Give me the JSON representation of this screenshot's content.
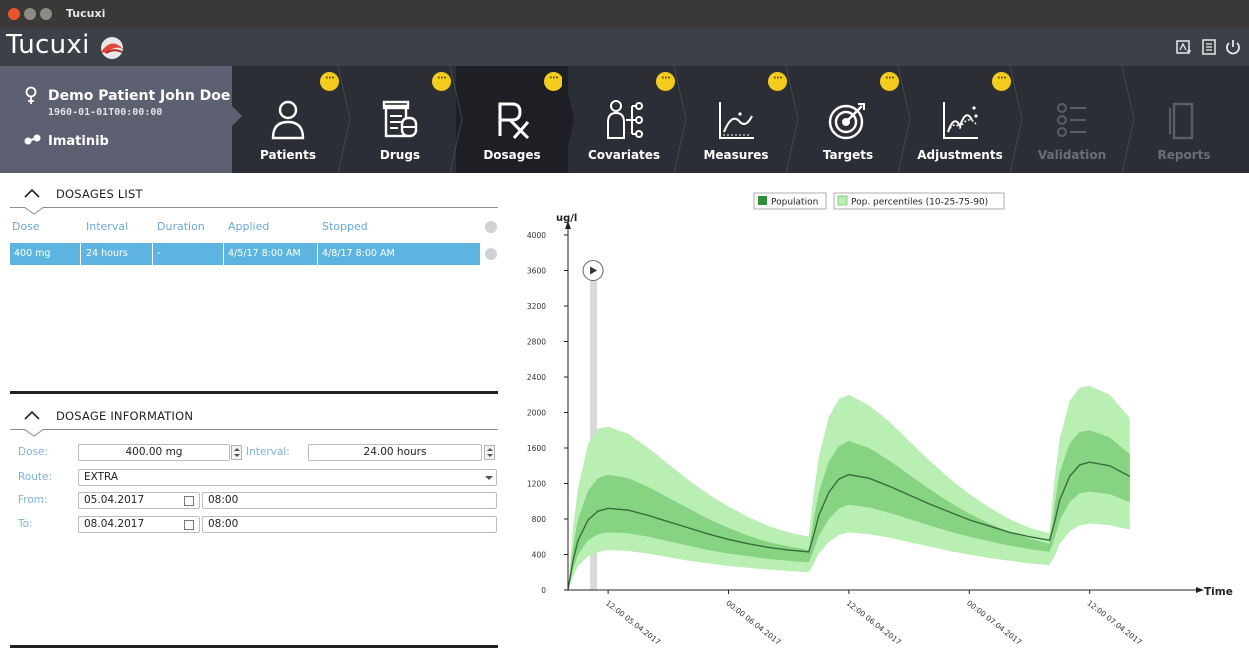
{
  "window": {
    "title": "Tucuxi"
  },
  "app": {
    "logo_text": "Tucuxi"
  },
  "header_icons": [
    "report-icon",
    "notes-icon",
    "power-icon"
  ],
  "patient": {
    "name": "Demo Patient John Doe",
    "dob": "1960-01-01T00:00:00",
    "drug": "Imatinib"
  },
  "tabs": [
    {
      "label": "Patients",
      "icon": "patient-icon",
      "state": "normal",
      "badge": true
    },
    {
      "label": "Drugs",
      "icon": "drug-box-icon",
      "state": "normal",
      "badge": true
    },
    {
      "label": "Dosages",
      "icon": "rx-icon",
      "state": "active",
      "badge": true
    },
    {
      "label": "Covariates",
      "icon": "covariates-icon",
      "state": "normal",
      "badge": true
    },
    {
      "label": "Measures",
      "icon": "measures-icon",
      "state": "normal",
      "badge": true
    },
    {
      "label": "Targets",
      "icon": "target-icon",
      "state": "normal",
      "badge": true
    },
    {
      "label": "Adjustments",
      "icon": "adjustments-icon",
      "state": "normal",
      "badge": true
    },
    {
      "label": "Validation",
      "icon": "validation-icon",
      "state": "disabled",
      "badge": false
    },
    {
      "label": "Reports",
      "icon": "report-doc-icon",
      "state": "disabled",
      "badge": false
    }
  ],
  "dosages_list": {
    "title": "DOSAGES LIST",
    "columns": [
      "Dose",
      "Interval",
      "Duration",
      "Applied",
      "Stopped"
    ],
    "rows": [
      {
        "dose": "400 mg",
        "interval": "24 hours",
        "duration": "-",
        "applied": "4/5/17 8:00 AM",
        "stopped": "4/8/17 8:00 AM"
      }
    ]
  },
  "dosage_info": {
    "title": "DOSAGE INFORMATION",
    "dose_label": "Dose:",
    "dose_value": "400.00 mg",
    "interval_label": "Interval:",
    "interval_value": "24.00 hours",
    "route_label": "Route:",
    "route_value": "EXTRA",
    "from_label": "From:",
    "from_date": "05.04.2017",
    "from_time": "08:00",
    "to_label": "To:",
    "to_date": "08.04.2017",
    "to_time": "08:00"
  },
  "chart_data": {
    "type": "area",
    "ylabel": "ug/l",
    "xlabel": "Time",
    "ylim": [
      0,
      4000
    ],
    "yticks": [
      0,
      400,
      800,
      1200,
      1600,
      2000,
      2400,
      2800,
      3200,
      3600,
      4000
    ],
    "xticks": [
      "12:00 05.04.2017",
      "00:00 06.04.2017",
      "12:00 06.04.2017",
      "00:00 07.04.2017",
      "12:00 07.04.2017"
    ],
    "xrange_hours": [
      0,
      62
    ],
    "xtick_hours": [
      4,
      16,
      28,
      40,
      52
    ],
    "legend": [
      "Population",
      "Pop. percentiles (10-25-75-90)"
    ],
    "legend_position": "top-center",
    "colors": {
      "population": "#2f8f3a",
      "band_outer": "#b9efb3",
      "band_inner": "#86d482",
      "median": "#3a6b3c"
    },
    "marker_hour": 2.5,
    "marker_y": 3600,
    "series": [
      {
        "name": "p90",
        "x": [
          0,
          0.5,
          1,
          2,
          3,
          4,
          6,
          8,
          10,
          12,
          14,
          16,
          18,
          20,
          22,
          24,
          24.5,
          25,
          26,
          27,
          28,
          30,
          32,
          34,
          36,
          38,
          40,
          42,
          44,
          46,
          48,
          48.5,
          49,
          50,
          51,
          52,
          54,
          56
        ],
        "values": [
          0,
          700,
          1150,
          1650,
          1820,
          1840,
          1760,
          1600,
          1420,
          1240,
          1080,
          940,
          820,
          720,
          650,
          600,
          1100,
          1500,
          1950,
          2150,
          2200,
          2080,
          1900,
          1680,
          1460,
          1260,
          1080,
          930,
          800,
          700,
          640,
          1250,
          1700,
          2130,
          2280,
          2300,
          2200,
          1940
        ]
      },
      {
        "name": "p75",
        "x": [
          0,
          0.5,
          1,
          2,
          3,
          4,
          6,
          8,
          10,
          12,
          14,
          16,
          18,
          20,
          22,
          24,
          24.5,
          25,
          26,
          27,
          28,
          30,
          32,
          34,
          36,
          38,
          40,
          42,
          44,
          46,
          48,
          48.5,
          49,
          50,
          51,
          52,
          54,
          56
        ],
        "values": [
          0,
          480,
          800,
          1120,
          1260,
          1300,
          1260,
          1160,
          1040,
          920,
          800,
          700,
          610,
          540,
          490,
          450,
          800,
          1100,
          1450,
          1620,
          1680,
          1600,
          1460,
          1300,
          1140,
          990,
          860,
          750,
          650,
          580,
          520,
          950,
          1320,
          1650,
          1780,
          1800,
          1720,
          1530
        ]
      },
      {
        "name": "median",
        "x": [
          0,
          0.5,
          1,
          2,
          3,
          4,
          6,
          8,
          10,
          12,
          14,
          16,
          18,
          20,
          22,
          24,
          24.5,
          25,
          26,
          27,
          28,
          30,
          32,
          34,
          36,
          38,
          40,
          42,
          44,
          46,
          48,
          48.5,
          49,
          50,
          51,
          52,
          54,
          56
        ],
        "values": [
          0,
          330,
          560,
          790,
          890,
          920,
          900,
          840,
          770,
          700,
          630,
          570,
          520,
          480,
          450,
          430,
          620,
          840,
          1100,
          1250,
          1300,
          1260,
          1170,
          1070,
          970,
          880,
          790,
          720,
          650,
          600,
          560,
          760,
          1010,
          1280,
          1410,
          1440,
          1400,
          1280
        ]
      },
      {
        "name": "p25",
        "x": [
          0,
          0.5,
          1,
          2,
          3,
          4,
          6,
          8,
          10,
          12,
          14,
          16,
          18,
          20,
          22,
          24,
          24.5,
          25,
          26,
          27,
          28,
          30,
          32,
          34,
          36,
          38,
          40,
          42,
          44,
          46,
          48,
          48.5,
          49,
          50,
          51,
          52,
          54,
          56
        ],
        "values": [
          0,
          230,
          400,
          560,
          630,
          650,
          640,
          600,
          550,
          500,
          450,
          410,
          380,
          350,
          330,
          310,
          450,
          610,
          800,
          920,
          960,
          930,
          870,
          800,
          730,
          660,
          600,
          550,
          500,
          460,
          430,
          580,
          780,
          990,
          1090,
          1110,
          1080,
          990
        ]
      },
      {
        "name": "p10",
        "x": [
          0,
          0.5,
          1,
          2,
          3,
          4,
          6,
          8,
          10,
          12,
          14,
          16,
          18,
          20,
          22,
          24,
          24.5,
          25,
          26,
          27,
          28,
          30,
          32,
          34,
          36,
          38,
          40,
          42,
          44,
          46,
          48,
          48.5,
          49,
          50,
          51,
          52,
          54,
          56
        ],
        "values": [
          0,
          150,
          270,
          380,
          430,
          450,
          440,
          410,
          370,
          330,
          300,
          270,
          250,
          230,
          215,
          200,
          300,
          410,
          540,
          620,
          650,
          630,
          590,
          540,
          490,
          440,
          400,
          360,
          330,
          300,
          280,
          380,
          520,
          660,
          730,
          750,
          730,
          680
        ]
      }
    ]
  }
}
